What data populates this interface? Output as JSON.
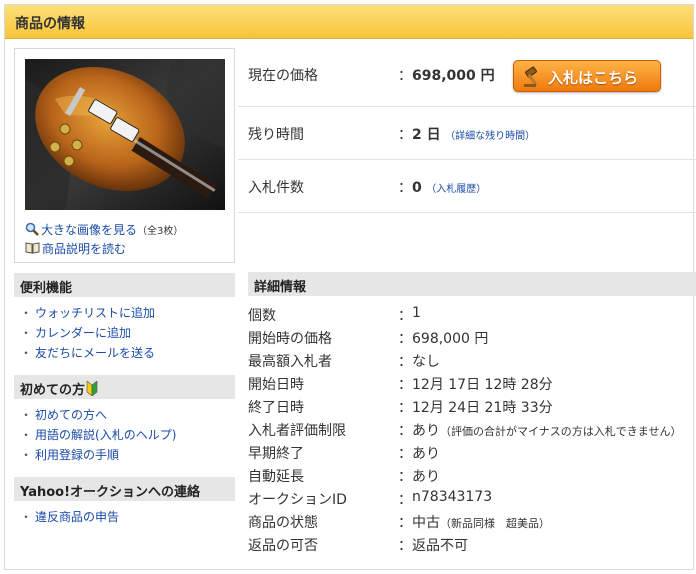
{
  "section_title": "商品の情報",
  "image_links": {
    "large_image": "大きな画像を見る",
    "large_image_count": "（全3枚）",
    "description": "商品説明を読む"
  },
  "price": {
    "current_label": "現在の価格",
    "current_value": "698,000 円",
    "bid_button": "入札はこちら",
    "remaining_label": "残り時間",
    "remaining_value": "2 日",
    "remaining_link": "（詳細な残り時間）",
    "bids_label": "入札件数",
    "bids_value": "0",
    "bids_link": "（入札履歴）"
  },
  "sidebar": {
    "convenience": {
      "title": "便利機能",
      "items": [
        "ウォッチリストに追加",
        "カレンダーに追加",
        "友だちにメールを送る"
      ]
    },
    "beginners": {
      "title": "初めての方",
      "items": [
        "初めての方へ",
        "用語の解説(入札のヘルプ)",
        "利用登録の手順"
      ]
    },
    "contact": {
      "title": "Yahoo!オークションへの連絡",
      "items": [
        "違反商品の申告"
      ]
    }
  },
  "details": {
    "title": "詳細情報",
    "rows": [
      {
        "key": "個数",
        "value": "1",
        "note": ""
      },
      {
        "key": "開始時の価格",
        "value": "698,000 円",
        "note": ""
      },
      {
        "key": "最高額入札者",
        "value": "なし",
        "note": ""
      },
      {
        "key": "開始日時",
        "value": "12月 17日 12時 28分",
        "note": ""
      },
      {
        "key": "終了日時",
        "value": "12月 24日 21時 33分",
        "note": ""
      },
      {
        "key": "入札者評価制限",
        "value": "あり",
        "note": "（評価の合計がマイナスの方は入札できません）"
      },
      {
        "key": "早期終了",
        "value": "あり",
        "note": ""
      },
      {
        "key": "自動延長",
        "value": "あり",
        "note": ""
      },
      {
        "key": "オークションID",
        "value": "n78343173",
        "note": ""
      },
      {
        "key": "商品の状態",
        "value": "中古",
        "note": "（新品同様　超美品）"
      },
      {
        "key": "返品の可否",
        "value": "返品不可",
        "note": ""
      }
    ]
  },
  "colors": {
    "title_bar": "#f8c53a",
    "bid_button": "#f07a0c",
    "link": "#1a4ba8",
    "section_bg": "#e6e6e6"
  }
}
